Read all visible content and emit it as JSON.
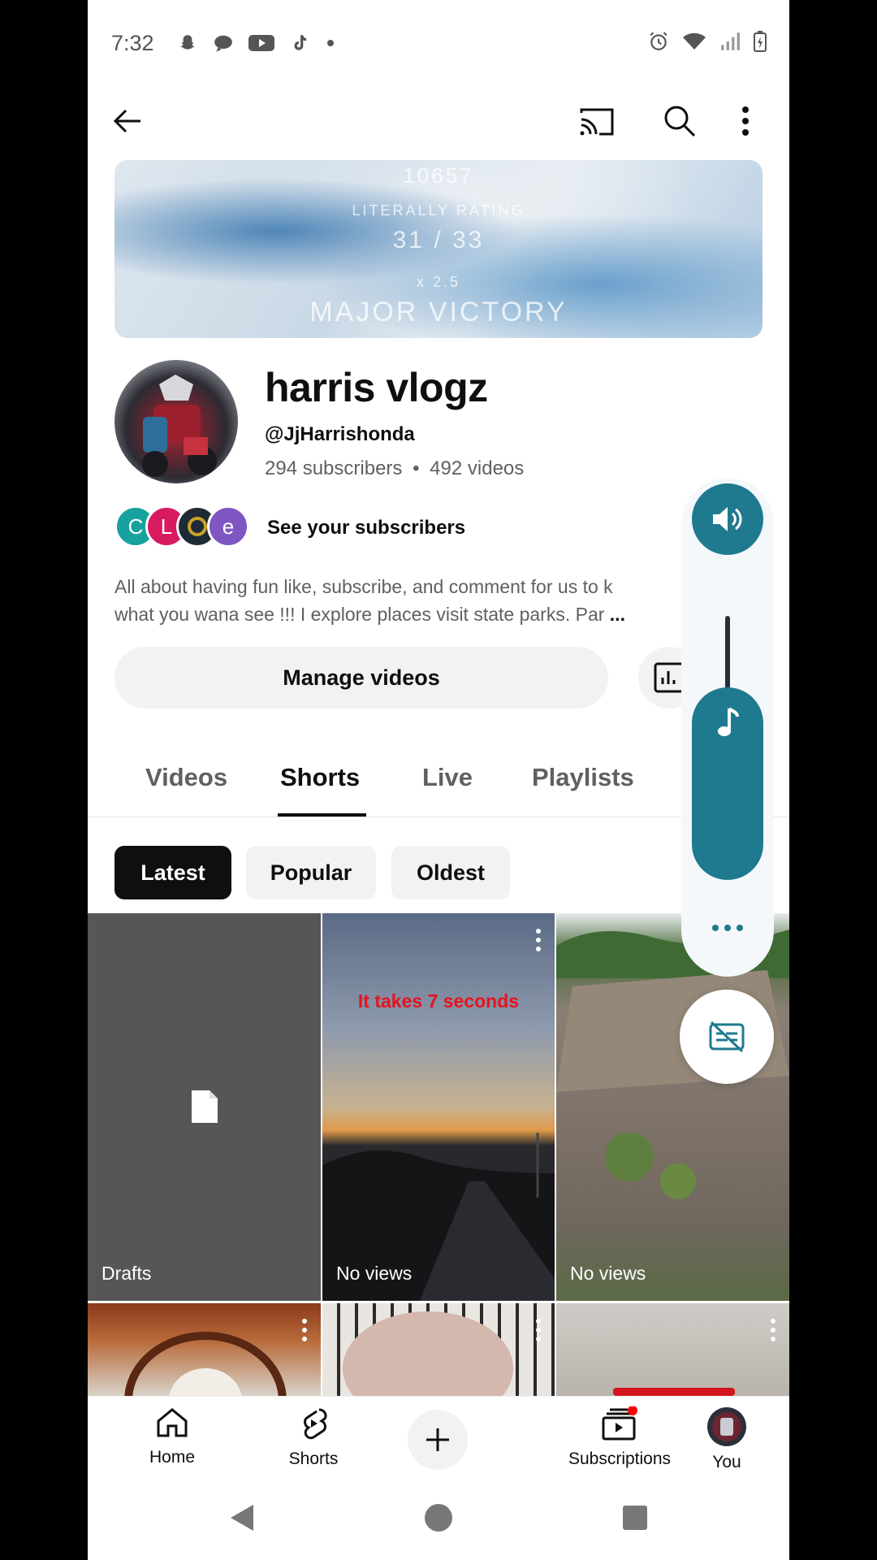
{
  "status_bar": {
    "time": "7:32",
    "left_icons": [
      "snapchat-icon",
      "messages-icon",
      "youtube-icon",
      "tiktok-icon",
      "dot-icon"
    ],
    "right_icons": [
      "alarm-icon",
      "wifi-icon",
      "signal-icon",
      "battery-icon"
    ]
  },
  "top_bar": {
    "icons": [
      "back-arrow-icon",
      "cast-icon",
      "search-icon",
      "more-vert-icon"
    ]
  },
  "banner": {
    "lines": [
      "10657",
      "LITERALLY RATING",
      "31 / 33",
      "x 2.5",
      "MAJOR VICTORY"
    ]
  },
  "channel": {
    "name": "harris vlogz",
    "handle": "@JjHarrishonda",
    "subscribers": "294 subscribers",
    "separator": "•",
    "videos": "492 videos",
    "subscriber_avatars": [
      {
        "letter": "C",
        "color": "#17a2a0"
      },
      {
        "letter": "L",
        "color": "#d81b60"
      },
      {
        "letter": "",
        "color": "#1e2a36"
      },
      {
        "letter": "e",
        "color": "#7e57c2"
      }
    ],
    "see_subscribers_label": "See your subscribers",
    "description_line1": "All about having fun like, subscribe, and comment for us to k",
    "description_line2": "what you wana see !!! I explore places visit state parks. Par",
    "description_more": "..."
  },
  "actions": {
    "manage_videos_label": "Manage videos"
  },
  "tabs": [
    {
      "label": "Videos"
    },
    {
      "label": "Shorts"
    },
    {
      "label": "Live"
    },
    {
      "label": "Playlists"
    }
  ],
  "active_tab": "Shorts",
  "filter_chips": [
    {
      "label": "Latest"
    },
    {
      "label": "Popular"
    },
    {
      "label": "Oldest"
    }
  ],
  "selected_chip": "Latest",
  "shorts": [
    {
      "label": "Drafts",
      "overlay_text": ""
    },
    {
      "label": "No views",
      "overlay_text": "It takes 7 seconds"
    },
    {
      "label": "No views",
      "overlay_text": ""
    }
  ],
  "volume_overlay": {
    "level": 0.45,
    "accent_color": "#1f7a8f"
  },
  "bottom_nav": [
    {
      "label": "Home",
      "icon": "home-icon"
    },
    {
      "label": "Shorts",
      "icon": "shorts-icon"
    },
    {
      "label": "",
      "icon": "create-plus-icon"
    },
    {
      "label": "Subscriptions",
      "icon": "subscriptions-icon"
    },
    {
      "label": "You",
      "icon": "profile-avatar"
    }
  ],
  "colors": {
    "accent_red": "#ff0000",
    "text_primary": "#0f0f0f",
    "text_secondary": "#606060",
    "chip_bg": "#f2f2f2"
  }
}
